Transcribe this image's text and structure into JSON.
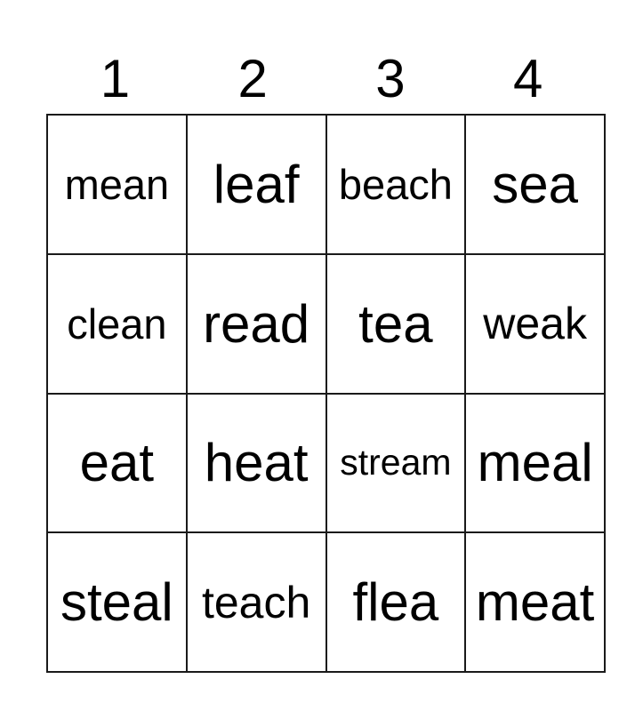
{
  "header": [
    "1",
    "2",
    "3",
    "4"
  ],
  "rows": [
    [
      {
        "text": "mean",
        "size": "s"
      },
      {
        "text": "leaf",
        "size": "l"
      },
      {
        "text": "beach",
        "size": "s"
      },
      {
        "text": "sea",
        "size": "l"
      }
    ],
    [
      {
        "text": "clean",
        "size": "s"
      },
      {
        "text": "read",
        "size": "l"
      },
      {
        "text": "tea",
        "size": "l"
      },
      {
        "text": "weak",
        "size": "m"
      }
    ],
    [
      {
        "text": "eat",
        "size": "l"
      },
      {
        "text": "heat",
        "size": "l"
      },
      {
        "text": "stream",
        "size": "xs"
      },
      {
        "text": "meal",
        "size": "l"
      }
    ],
    [
      {
        "text": "steal",
        "size": "l"
      },
      {
        "text": "teach",
        "size": "m"
      },
      {
        "text": "flea",
        "size": "l"
      },
      {
        "text": "meat",
        "size": "l"
      }
    ]
  ]
}
